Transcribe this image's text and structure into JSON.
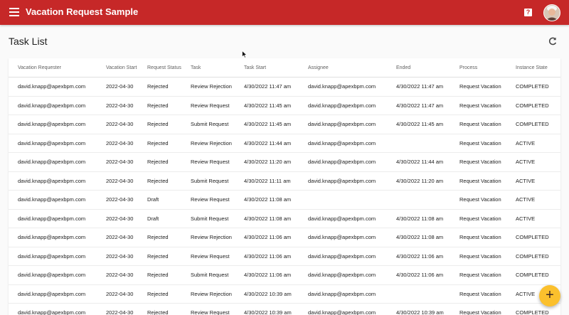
{
  "app": {
    "title": "Vacation Request Sample",
    "help_label": "?"
  },
  "page": {
    "title": "Task List"
  },
  "table": {
    "columns": [
      "Vacation Requester",
      "Vacation Start",
      "Request Status",
      "Task",
      "Task Start",
      "Assignee",
      "Ended",
      "Process",
      "Instance State"
    ],
    "rows": [
      [
        "david.knapp@apexbpm.com",
        "2022-04-30",
        "Rejected",
        "Review Rejection",
        "4/30/2022 11:47 am",
        "david.knapp@apexbpm.com",
        "4/30/2022 11:47 am",
        "Request Vacation",
        "COMPLETED"
      ],
      [
        "david.knapp@apexbpm.com",
        "2022-04-30",
        "Rejected",
        "Review Request",
        "4/30/2022 11:45 am",
        "david.knapp@apexbpm.com",
        "4/30/2022 11:47 am",
        "Request Vacation",
        "COMPLETED"
      ],
      [
        "david.knapp@apexbpm.com",
        "2022-04-30",
        "Rejected",
        "Submit Request",
        "4/30/2022 11:45 am",
        "david.knapp@apexbpm.com",
        "4/30/2022 11:45 am",
        "Request Vacation",
        "COMPLETED"
      ],
      [
        "david.knapp@apexbpm.com",
        "2022-04-30",
        "Rejected",
        "Review Rejection",
        "4/30/2022 11:44 am",
        "david.knapp@apexbpm.com",
        "",
        "Request Vacation",
        "ACTIVE"
      ],
      [
        "david.knapp@apexbpm.com",
        "2022-04-30",
        "Rejected",
        "Review Request",
        "4/30/2022 11:20 am",
        "david.knapp@apexbpm.com",
        "4/30/2022 11:44 am",
        "Request Vacation",
        "ACTIVE"
      ],
      [
        "david.knapp@apexbpm.com",
        "2022-04-30",
        "Rejected",
        "Submit Request",
        "4/30/2022 11:11 am",
        "david.knapp@apexbpm.com",
        "4/30/2022 11:20 am",
        "Request Vacation",
        "ACTIVE"
      ],
      [
        "david.knapp@apexbpm.com",
        "2022-04-30",
        "Draft",
        "Review Request",
        "4/30/2022 11:08 am",
        "",
        "",
        "Request Vacation",
        "ACTIVE"
      ],
      [
        "david.knapp@apexbpm.com",
        "2022-04-30",
        "Draft",
        "Submit Request",
        "4/30/2022 11:08 am",
        "david.knapp@apexbpm.com",
        "4/30/2022 11:08 am",
        "Request Vacation",
        "ACTIVE"
      ],
      [
        "david.knapp@apexbpm.com",
        "2022-04-30",
        "Rejected",
        "Review Rejection",
        "4/30/2022 11:06 am",
        "david.knapp@apexbpm.com",
        "4/30/2022 11:08 am",
        "Request Vacation",
        "COMPLETED"
      ],
      [
        "david.knapp@apexbpm.com",
        "2022-04-30",
        "Rejected",
        "Review Request",
        "4/30/2022 11:06 am",
        "david.knapp@apexbpm.com",
        "4/30/2022 11:06 am",
        "Request Vacation",
        "COMPLETED"
      ],
      [
        "david.knapp@apexbpm.com",
        "2022-04-30",
        "Rejected",
        "Submit Request",
        "4/30/2022 11:06 am",
        "david.knapp@apexbpm.com",
        "4/30/2022 11:06 am",
        "Request Vacation",
        "COMPLETED"
      ],
      [
        "david.knapp@apexbpm.com",
        "2022-04-30",
        "Rejected",
        "Review Rejection",
        "4/30/2022 10:39 am",
        "david.knapp@apexbpm.com",
        "",
        "Request Vacation",
        "ACTIVE"
      ],
      [
        "david.knapp@apexbpm.com",
        "2022-04-30",
        "Rejected",
        "Review Request",
        "4/30/2022 10:39 am",
        "david.knapp@apexbpm.com",
        "4/30/2022 10:39 am",
        "Request Vacation",
        "COMPLETED"
      ]
    ]
  },
  "fab": {
    "label": "+"
  },
  "colors": {
    "appbar": "#c62828",
    "fab": "#fbc02d",
    "background": "#fafafa"
  },
  "icons": {
    "menu": "menu-icon",
    "help": "help-icon",
    "refresh": "refresh-icon",
    "add": "add-icon",
    "avatar": "user-avatar"
  }
}
